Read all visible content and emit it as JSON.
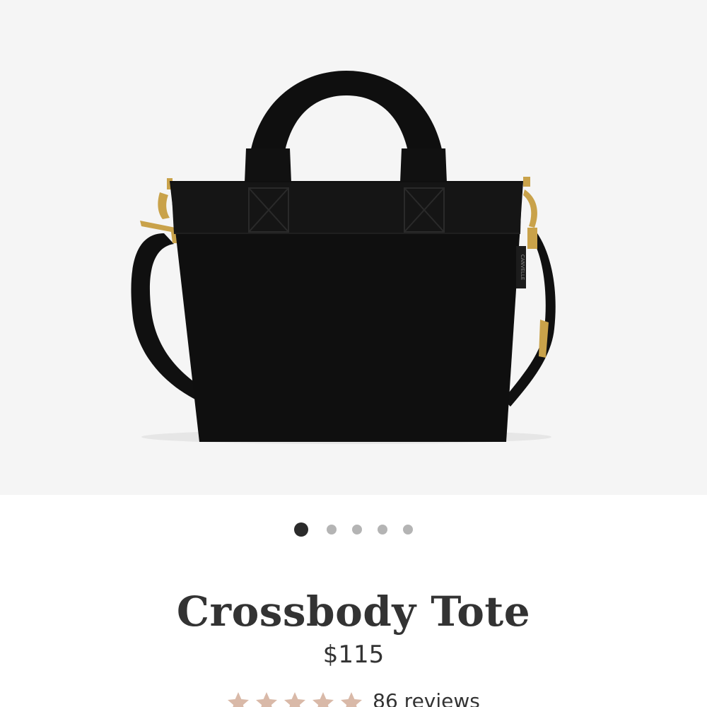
{
  "product": {
    "title": "Crossbody Tote",
    "price": "$115",
    "image_icon": "product-photo-crossbody-tote",
    "brand_label": "CANVELLE"
  },
  "gallery": {
    "slide_count": 5,
    "active_slide": 1,
    "background": "#f5f5f5"
  },
  "rating": {
    "stars": 5,
    "reviews_label": "86 reviews",
    "star_color": "#d9b9a8"
  },
  "colors": {
    "text": "#333333",
    "dot_active": "#2b2b2b",
    "dot_inactive": "#b4b4b4",
    "bag": "#0f0f0f",
    "hardware": "#c9a24a"
  }
}
